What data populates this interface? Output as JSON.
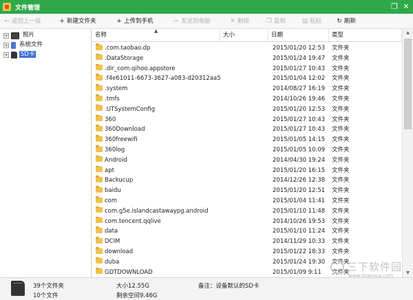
{
  "window": {
    "title": "文件管理",
    "controls": {
      "restore": "❐",
      "close": "✕"
    }
  },
  "toolbar": [
    {
      "icon": "up-level-icon",
      "glyph": "←",
      "label": "返回上一级",
      "enabled": false
    },
    {
      "icon": "new-folder-icon",
      "glyph": "+",
      "label": "新建文件夹",
      "enabled": true
    },
    {
      "icon": "upload-icon",
      "glyph": "+",
      "label": "上传到手机",
      "enabled": true
    },
    {
      "icon": "send-to-pc-icon",
      "glyph": "⇨",
      "label": "发送到电脑",
      "enabled": false
    },
    {
      "icon": "delete-icon",
      "glyph": "✕",
      "label": "删除",
      "enabled": false
    },
    {
      "icon": "copy-icon",
      "glyph": "❐",
      "label": "复制",
      "enabled": false
    },
    {
      "icon": "paste-icon",
      "glyph": "▤",
      "label": "粘贴",
      "enabled": false
    },
    {
      "icon": "refresh-icon",
      "glyph": "↻",
      "label": "刷新",
      "enabled": true
    }
  ],
  "tree": [
    {
      "label": "照片",
      "icon": "photos-icon",
      "expander": "+",
      "selected": false
    },
    {
      "label": "系统文件",
      "icon": "phone-icon",
      "expander": "+",
      "selected": false
    },
    {
      "label": "SD卡",
      "icon": "sd-card-icon",
      "expander": "+",
      "selected": true
    }
  ],
  "list": {
    "columns": [
      "名称",
      "大小",
      "日期",
      "类型"
    ],
    "sort_indicator": "▲",
    "rows": [
      {
        "name": ".com.taobao.dp",
        "size": "",
        "date": "2015/01/20 12:53",
        "type": "文件夹"
      },
      {
        "name": ".DataStorage",
        "size": "",
        "date": "2015/01/24 19:47",
        "type": "文件夹"
      },
      {
        "name": ".dir_com.qihoo.appstore",
        "size": "",
        "date": "2015/01/27 10:43",
        "type": "文件夹"
      },
      {
        "name": ".f4e61011-6673-3627-a083-d20312aa5...",
        "size": "",
        "date": "2015/01/04 12:02",
        "type": "文件夹"
      },
      {
        "name": ".system",
        "size": "",
        "date": "2014/08/27 16:19",
        "type": "文件夹"
      },
      {
        "name": ".tmfs",
        "size": "",
        "date": "2014/10/26 19:46",
        "type": "文件夹"
      },
      {
        "name": ".UTSystemConfig",
        "size": "",
        "date": "2015/01/20 12:53",
        "type": "文件夹"
      },
      {
        "name": "360",
        "size": "",
        "date": "2015/01/27 10:43",
        "type": "文件夹"
      },
      {
        "name": "360Download",
        "size": "",
        "date": "2015/01/27 10:43",
        "type": "文件夹"
      },
      {
        "name": "360freewifi",
        "size": "",
        "date": "2015/01/05 14:15",
        "type": "文件夹"
      },
      {
        "name": "360log",
        "size": "",
        "date": "2015/01/05 10:09",
        "type": "文件夹"
      },
      {
        "name": "Android",
        "size": "",
        "date": "2014/04/30 19:24",
        "type": "文件夹"
      },
      {
        "name": "apt",
        "size": "",
        "date": "2015/01/20 16:15",
        "type": "文件夹"
      },
      {
        "name": "Backucup",
        "size": "",
        "date": "2014/12/26 12:38",
        "type": "文件夹"
      },
      {
        "name": "baidu",
        "size": "",
        "date": "2015/01/20 12:51",
        "type": "文件夹"
      },
      {
        "name": "com",
        "size": "",
        "date": "2015/01/04 11:41",
        "type": "文件夹"
      },
      {
        "name": "com.g5e.islandcastawaypg.android",
        "size": "",
        "date": "2015/01/10 11:48",
        "type": "文件夹"
      },
      {
        "name": "com.tencent.qqlive",
        "size": "",
        "date": "2014/10/26 19:53",
        "type": "文件夹"
      },
      {
        "name": "data",
        "size": "",
        "date": "2015/01/10 11:24",
        "type": "文件夹"
      },
      {
        "name": "DCIM",
        "size": "",
        "date": "2014/11/29 10:33",
        "type": "文件夹"
      },
      {
        "name": "download",
        "size": "",
        "date": "2015/01/22 18:33",
        "type": "文件夹"
      },
      {
        "name": "duba",
        "size": "",
        "date": "2015/01/24 19:30",
        "type": "文件夹"
      },
      {
        "name": "GDTDOWNLOAD",
        "size": "",
        "date": "2015/01/09 9:11",
        "type": "文件夹"
      }
    ]
  },
  "scrollbar": {
    "up": "▲",
    "down": "▼"
  },
  "status": {
    "folders": "39个文件夹",
    "files": "10个文件",
    "size": "大小12.55G",
    "free": "剩余空间9.46G",
    "note": "备注：设备默认的SD卡"
  },
  "watermark": {
    "text": "三下软件园",
    "url": "www.downxia.com"
  }
}
